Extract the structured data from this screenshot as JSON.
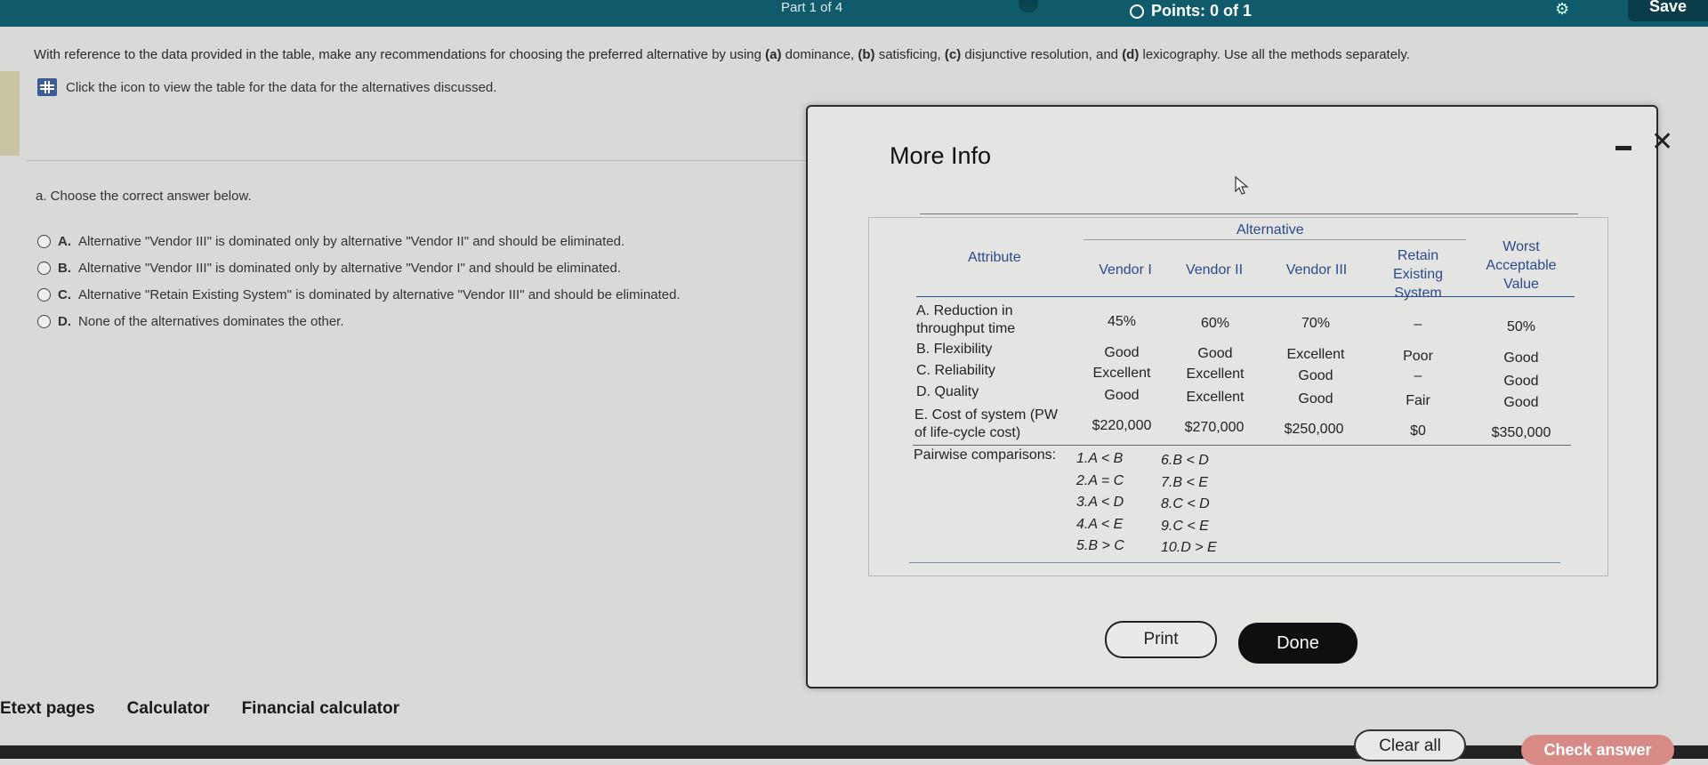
{
  "header": {
    "part": "Part 1 of 4",
    "points": "Points: 0 of 1",
    "save": "Save"
  },
  "question": {
    "text_pre": "With reference to the data provided in the table, make any recommendations for choosing the preferred alternative by using ",
    "a": "(a)",
    "a_t": " dominance, ",
    "b": "(b)",
    "b_t": " satisficing, ",
    "c": "(c)",
    "c_t": " disjunctive resolution, and ",
    "d": "(d)",
    "d_t": " lexicography. Use all the methods separately.",
    "view_link": "Click the icon to view the table for the data for the alternatives discussed."
  },
  "part_a": {
    "prompt": "a. Choose the correct answer below.",
    "options": [
      {
        "letter": "A.",
        "text": "Alternative \"Vendor III\" is dominated only by alternative \"Vendor II\" and should be eliminated."
      },
      {
        "letter": "B.",
        "text": "Alternative \"Vendor III\" is dominated only by alternative \"Vendor I\" and should be eliminated."
      },
      {
        "letter": "C.",
        "text": "Alternative \"Retain Existing System\" is dominated by alternative \"Vendor III\" and should be eliminated."
      },
      {
        "letter": "D.",
        "text": "None of the alternatives dominates the other."
      }
    ]
  },
  "footer": {
    "etext": "Etext pages",
    "calculator": "Calculator",
    "financial": "Financial calculator",
    "clear_all": "Clear all",
    "check_answer": "Check answer"
  },
  "modal": {
    "title": "More Info",
    "print": "Print",
    "done": "Done",
    "table": {
      "group_header": "Alternative",
      "attribute_header": "Attribute",
      "columns": [
        "Vendor I",
        "Vendor II",
        "Vendor III",
        "Retain Existing System",
        "Worst Acceptable Value"
      ],
      "col_lines": [
        [
          "Vendor I"
        ],
        [
          "Vendor II"
        ],
        [
          "Vendor III"
        ],
        [
          "Retain",
          "Existing",
          "System"
        ],
        [
          "Worst",
          "Acceptable",
          "Value"
        ]
      ],
      "rows": [
        {
          "attr1": "A. Reduction in",
          "attr2": "throughput time",
          "values": [
            "45%",
            "60%",
            "70%",
            "–",
            "50%"
          ]
        },
        {
          "attr1": "B. Flexibility",
          "attr2": "",
          "values": [
            "Good",
            "Good",
            "Excellent",
            "Poor",
            "Good"
          ]
        },
        {
          "attr1": "C. Reliability",
          "attr2": "",
          "values": [
            "Excellent",
            "Excellent",
            "Good",
            "–",
            "Good"
          ]
        },
        {
          "attr1": "D. Quality",
          "attr2": "",
          "values": [
            "Good",
            "Excellent",
            "Good",
            "Fair",
            "Good"
          ]
        },
        {
          "attr1": "E. Cost of system (PW",
          "attr2": "of life-cycle cost)",
          "values": [
            "$220,000",
            "$270,000",
            "$250,000",
            "$0",
            "$350,000"
          ]
        }
      ],
      "pairwise_label": "Pairwise comparisons:",
      "pairwise_left": [
        "1.A < B",
        "2.A = C",
        "3.A < D",
        "4.A < E",
        "5.B > C"
      ],
      "pairwise_right": [
        "6.B < D",
        "7.B < E",
        "8.C < D",
        "9.C < E",
        "10.D > E"
      ]
    }
  }
}
